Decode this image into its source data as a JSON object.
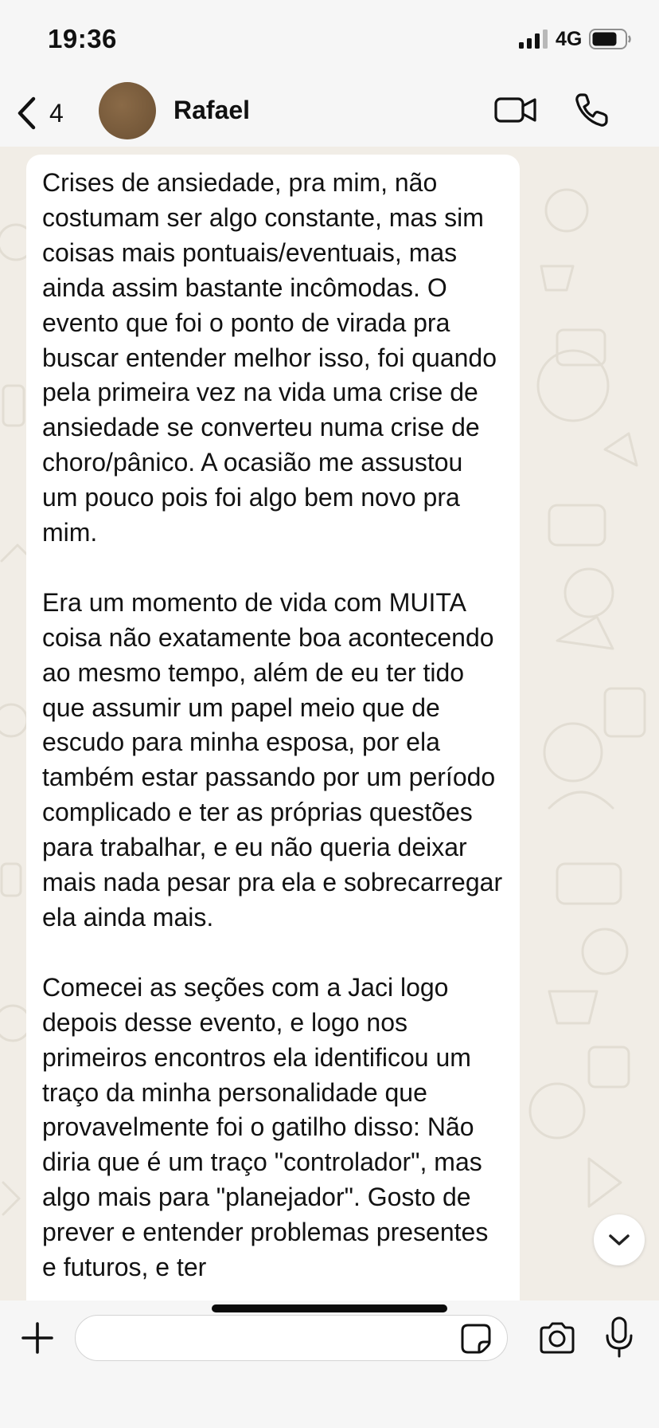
{
  "status_bar": {
    "time": "19:36",
    "network": "4G",
    "icons": [
      "signal-icon",
      "battery-icon"
    ]
  },
  "header": {
    "back_count": "4",
    "contact_name": "Rafael",
    "icons": [
      "chevron-left-icon",
      "video-camera-icon",
      "phone-icon"
    ]
  },
  "message": {
    "paragraphs": [
      "Crises de ansiedade, pra mim, não costumam ser algo constante, mas sim coisas mais pontuais/eventuais, mas ainda assim bastante incômodas. O evento que foi o ponto de virada pra buscar entender melhor isso, foi quando pela primeira vez na vida uma crise de ansiedade se converteu numa crise de choro/pânico. A ocasião me assustou um pouco pois foi algo bem novo pra mim.",
      "Era um momento de vida com MUITA coisa não exatamente boa acontecendo ao mesmo tempo, além de eu ter tido que assumir um papel meio que de escudo para minha esposa, por ela também estar passando por um período complicado e ter as próprias questões para trabalhar, e eu não queria deixar mais nada pesar pra ela e sobrecarregar ela ainda mais.",
      "Comecei as seções com a Jaci logo depois desse evento, e logo nos primeiros encontros ela identificou um traço da minha personalidade que provavelmente foi o gatilho disso: Não diria que é um traço \"controlador\", mas algo mais para \"planejador\". Gosto de prever e entender problemas presentes e futuros, e ter"
    ]
  },
  "composer": {
    "input_value": "",
    "icons": [
      "plus-icon",
      "sticker-icon",
      "camera-icon",
      "microphone-icon"
    ]
  },
  "colors": {
    "bar_background": "#f6f6f6",
    "chat_background": "#f1ede6",
    "bubble": "#ffffff",
    "avatar": "#7a5c3c"
  }
}
